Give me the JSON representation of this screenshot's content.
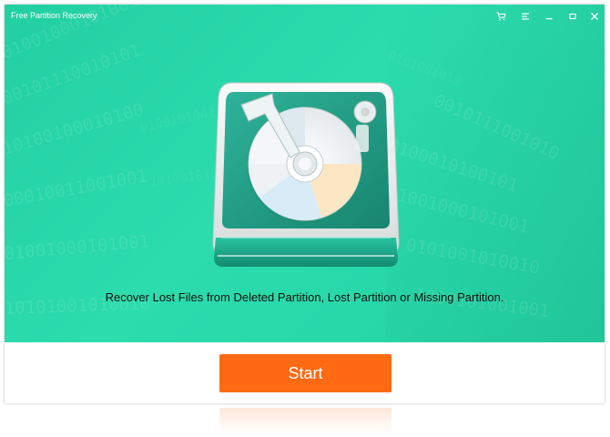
{
  "window": {
    "title": "Free Partition Recovery"
  },
  "titlebar_icons": [
    "cart-icon",
    "menu-icon",
    "minimize-icon",
    "maximize-icon",
    "close-icon"
  ],
  "hero": {
    "tagline": "Recover Lost Files from Deleted Partition, Lost Partition or Missing Partition."
  },
  "actions": {
    "start_label": "Start"
  },
  "colors": {
    "hero_bg": "#2cdcad",
    "accent": "#ff6a13",
    "text_on_hero": "#111111"
  }
}
